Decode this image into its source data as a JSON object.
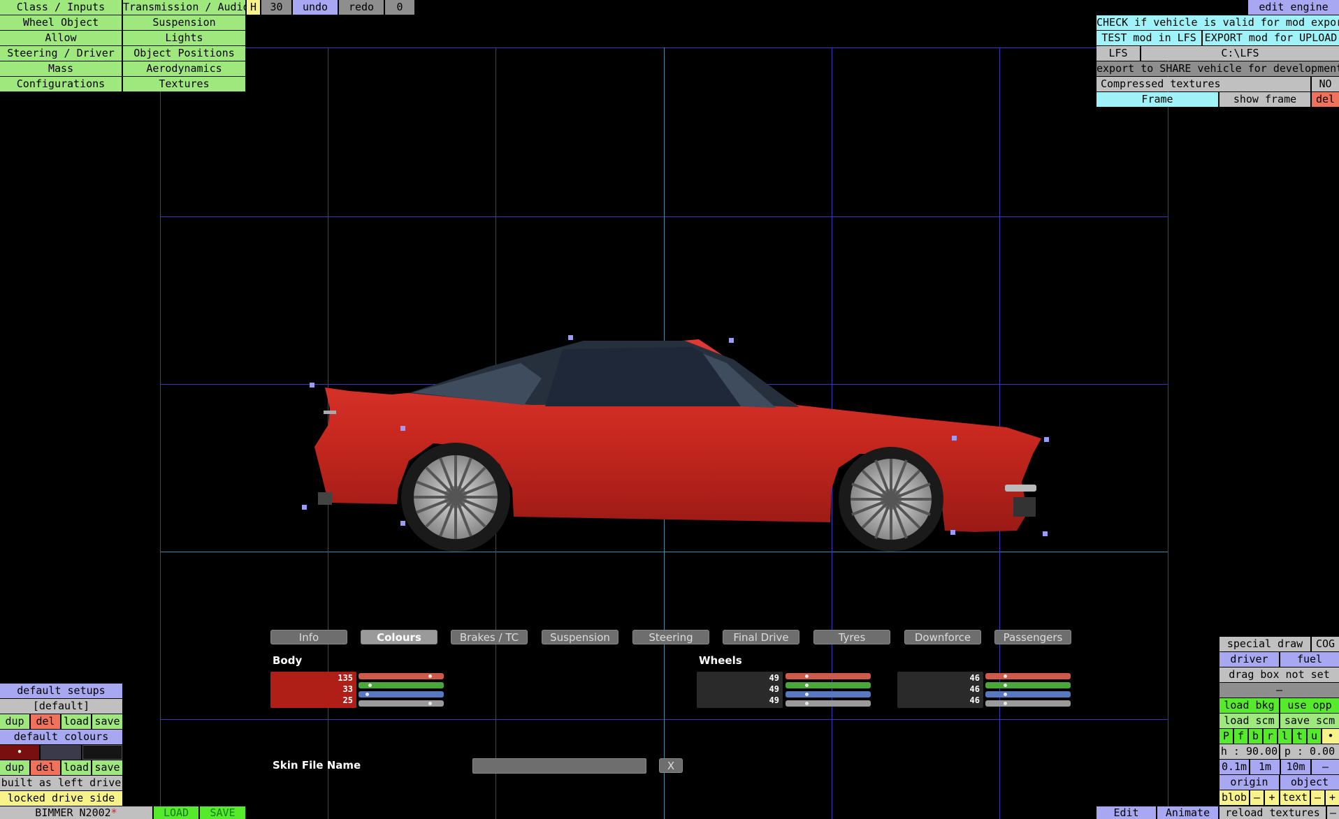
{
  "top_menu": {
    "left_col": [
      "Class / Inputs",
      "Wheel Object",
      "Allow",
      "Steering / Driver",
      "Mass",
      "Configurations"
    ],
    "right_col": [
      "Transmission / Audio",
      "Suspension",
      "Lights",
      "Object Positions",
      "Aerodynamics",
      "Textures"
    ]
  },
  "top_toolbar": {
    "h": "H",
    "step": "30",
    "undo": "undo",
    "redo": "redo",
    "count": "0"
  },
  "right_panel": {
    "edit_engine": "edit engine",
    "check": "CHECK if vehicle is valid for mod export",
    "test": "TEST mod in LFS",
    "export_upload": "EXPORT mod for UPLOAD",
    "lfs": "LFS",
    "path": "C:\\LFS",
    "share": "export to SHARE vehicle for development",
    "compressed_label": "Compressed textures",
    "compressed_value": "NO",
    "frame": "Frame",
    "show_frame": "show frame",
    "del": "del"
  },
  "tabs": [
    "Info",
    "Colours",
    "Brakes / TC",
    "Suspension",
    "Steering",
    "Final Drive",
    "Tyres",
    "Downforce",
    "Passengers"
  ],
  "selected_tab": "Colours",
  "colours": {
    "body_label": "Body",
    "body_rgb": [
      "135",
      "33",
      "25"
    ],
    "body_color": "#87211a",
    "wheels_label": "Wheels",
    "wheels1_rgb": [
      "49",
      "49",
      "49"
    ],
    "wheels2_rgb": [
      "46",
      "46",
      "46"
    ]
  },
  "skin": {
    "label": "Skin File Name",
    "value": "",
    "clear": "X"
  },
  "left_panel": {
    "default_setups": "default setups",
    "default_name": "[default]",
    "dup": "dup",
    "del": "del",
    "load": "load",
    "save": "save",
    "default_colours": "default colours",
    "swatch_dot": "•",
    "built_left": "built as left drive",
    "locked_side": "locked drive side"
  },
  "status_bar": {
    "vehicle": "BIMMER N2002",
    "modified": "*",
    "load": "LOAD",
    "save": "SAVE"
  },
  "right_tools": {
    "special_draw": "special draw",
    "cog": "COG",
    "driver": "driver",
    "fuel": "fuel",
    "drag_box": "drag box not set",
    "dash": "–",
    "load_bkg": "load bkg",
    "use_opp": "use opp",
    "load_scm": "load scm",
    "save_scm": "save scm",
    "letters": [
      "P",
      "f",
      "b",
      "r",
      "l",
      "t",
      "u",
      "•"
    ],
    "heading": "h : 90.00",
    "pitch": "p : 0.00",
    "step1": "0.1m",
    "step2": "1m",
    "step3": "10m",
    "minus": "–",
    "origin": "origin",
    "object": "object",
    "blob": "blob",
    "text": "text",
    "plus": "+",
    "edit": "Edit",
    "animate": "Animate",
    "reload": "reload textures"
  }
}
